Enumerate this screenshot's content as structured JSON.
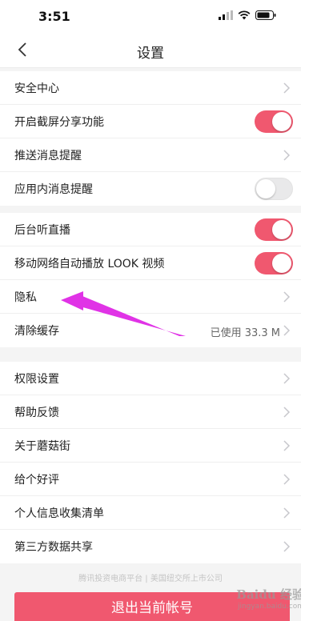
{
  "status_bar": {
    "time": "3:51"
  },
  "nav": {
    "title": "设置"
  },
  "groups": [
    {
      "items": [
        {
          "label": "安全中心",
          "kind": "link"
        },
        {
          "label": "开启截屏分享功能",
          "kind": "toggle",
          "on": true
        },
        {
          "label": "推送消息提醒",
          "kind": "link"
        },
        {
          "label": "应用内消息提醒",
          "kind": "toggle",
          "on": false
        }
      ]
    },
    {
      "items": [
        {
          "label": "后台听直播",
          "kind": "toggle",
          "on": true
        },
        {
          "label": "移动网络自动播放 LOOK 视频",
          "kind": "toggle",
          "on": true
        },
        {
          "label": "隐私",
          "kind": "link"
        },
        {
          "label": "清除缓存",
          "kind": "value",
          "value": "已使用 33.3 M"
        }
      ]
    },
    {
      "items": [
        {
          "label": "权限设置",
          "kind": "link"
        },
        {
          "label": "帮助反馈",
          "kind": "link"
        },
        {
          "label": "关于蘑菇街",
          "kind": "link"
        },
        {
          "label": "给个好评",
          "kind": "link"
        },
        {
          "label": "个人信息收集清单",
          "kind": "link"
        },
        {
          "label": "第三方数据共享",
          "kind": "link"
        }
      ]
    }
  ],
  "footer": {
    "note": "腾讯投资电商平台 | 美国纽交所上市公司"
  },
  "logout": {
    "label": "退出当前帐号"
  },
  "watermark": {
    "brand": "Baidu 经验",
    "url": "jingyan.baidu.com"
  },
  "colors": {
    "accent": "#f0586f",
    "annotation_arrow": "#e033e6"
  }
}
